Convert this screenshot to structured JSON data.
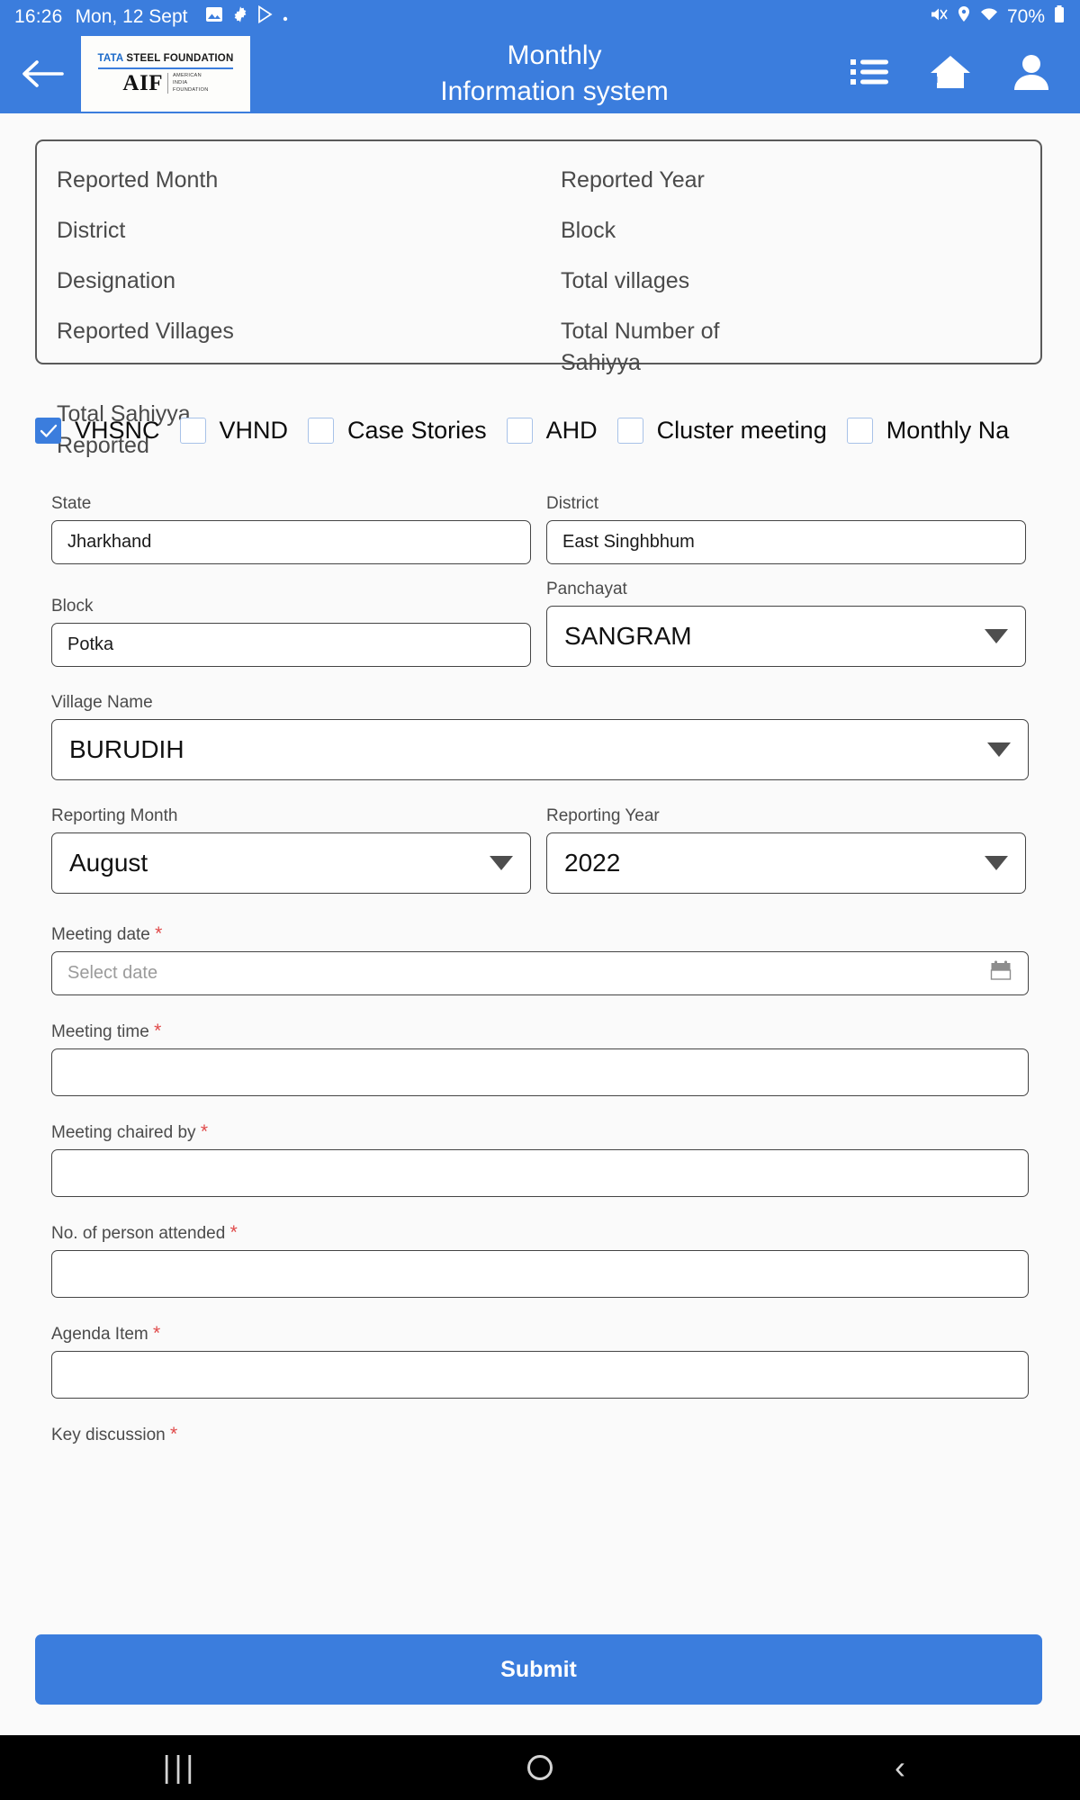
{
  "status_bar": {
    "time": "16:26",
    "date": "Mon, 12 Sept",
    "battery": "70%",
    "left_icons": [
      "image-icon",
      "gear-icon",
      "play-store-icon",
      "dot-icon"
    ],
    "right_icons": [
      "mute-icon",
      "location-icon",
      "wifi-icon",
      "battery-icon"
    ]
  },
  "app_bar": {
    "back_label": "back-arrow",
    "title_line1": "Monthly",
    "title_line2": "Information system",
    "logo": {
      "top_brand_1": "TATA",
      "top_brand_2": "STEEL FOUNDATION",
      "aif": "AIF",
      "sub_line1": "AMERICAN",
      "sub_line2": "INDIA",
      "sub_line3": "FOUNDATION"
    },
    "icons": [
      "list-icon",
      "home-icon",
      "profile-icon"
    ],
    "accent_color": "#3b7ddd"
  },
  "info_card": {
    "fields": [
      "Reported Month",
      "Reported Year",
      "District",
      "Block",
      "Designation",
      "Total villages",
      "Reported Villages",
      "Total Number of Sahiyya",
      "Total Sahiyya Reported"
    ]
  },
  "checkboxes": [
    {
      "label": "VHSNC",
      "checked": true
    },
    {
      "label": "VHND",
      "checked": false
    },
    {
      "label": "Case Stories",
      "checked": false
    },
    {
      "label": "AHD",
      "checked": false
    },
    {
      "label": "Cluster meeting",
      "checked": false
    },
    {
      "label": "Monthly Na",
      "checked": false
    }
  ],
  "form": {
    "state": {
      "label": "State",
      "value": "Jharkhand"
    },
    "district": {
      "label": "District",
      "value": "East Singhbhum"
    },
    "block": {
      "label": "Block",
      "value": "Potka"
    },
    "panchayat": {
      "label": "Panchayat",
      "value": "SANGRAM"
    },
    "village": {
      "label": "Village Name",
      "value": "BURUDIH"
    },
    "reporting_month": {
      "label": "Reporting Month",
      "value": "August"
    },
    "reporting_year": {
      "label": "Reporting Year",
      "value": "2022"
    },
    "meeting_date": {
      "label": "Meeting date",
      "required": "*",
      "placeholder": "Select date",
      "value": ""
    },
    "meeting_time": {
      "label": "Meeting time",
      "required": "*",
      "value": ""
    },
    "meeting_chaired_by": {
      "label": "Meeting chaired by",
      "required": "*",
      "value": ""
    },
    "persons_attended": {
      "label": "No. of person attended",
      "required": "*",
      "value": ""
    },
    "agenda_item": {
      "label": "Agenda Item",
      "required": "*",
      "value": ""
    },
    "key_discussion": {
      "label": "Key discussion",
      "required": "*"
    },
    "submit_label": "Submit"
  },
  "nav_bar": {
    "recents": "|||",
    "home": "home-circle",
    "back": "‹"
  }
}
